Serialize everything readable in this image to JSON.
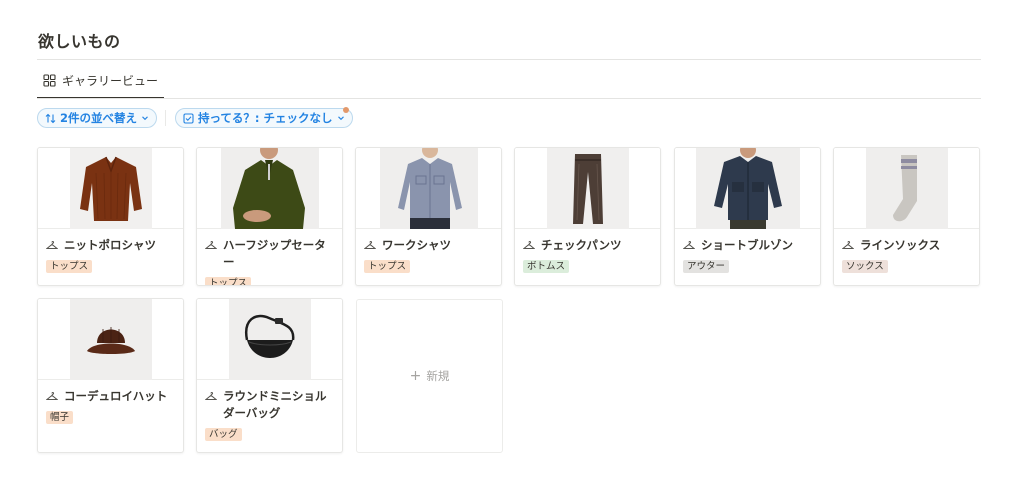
{
  "page": {
    "title": "欲しいもの"
  },
  "view_tab": {
    "label": "ギャラリービュー",
    "icon": "grid-icon"
  },
  "sort_chip": {
    "label": "2件の並べ替え",
    "icon": "sort-arrows-icon"
  },
  "filter_chip": {
    "label": "持ってる？: チェックなし",
    "icon": "checkbox-icon",
    "dot_color": "#e3996b"
  },
  "accent_color": "#2383e2",
  "cards": [
    {
      "name": "ニットポロシャツ",
      "tag": "トップス",
      "tag_color": "#fadec9"
    },
    {
      "name": "ハーフジップセーター",
      "tag": "トップス",
      "tag_color": "#fadec9"
    },
    {
      "name": "ワークシャツ",
      "tag": "トップス",
      "tag_color": "#fadec9"
    },
    {
      "name": "チェックパンツ",
      "tag": "ボトムス",
      "tag_color": "#dbeddb"
    },
    {
      "name": "ショートブルゾン",
      "tag": "アウター",
      "tag_color": "#e3e2e0"
    },
    {
      "name": "ラインソックス",
      "tag": "ソックス",
      "tag_color": "#eee0da"
    },
    {
      "name": "コーデュロイハット",
      "tag": "帽子",
      "tag_color": "#fadec9"
    },
    {
      "name": "ラウンドミニショルダーバッグ",
      "tag": "バッグ",
      "tag_color": "#fadec9"
    }
  ],
  "new_card": {
    "label": "新規",
    "icon": "plus-icon"
  }
}
